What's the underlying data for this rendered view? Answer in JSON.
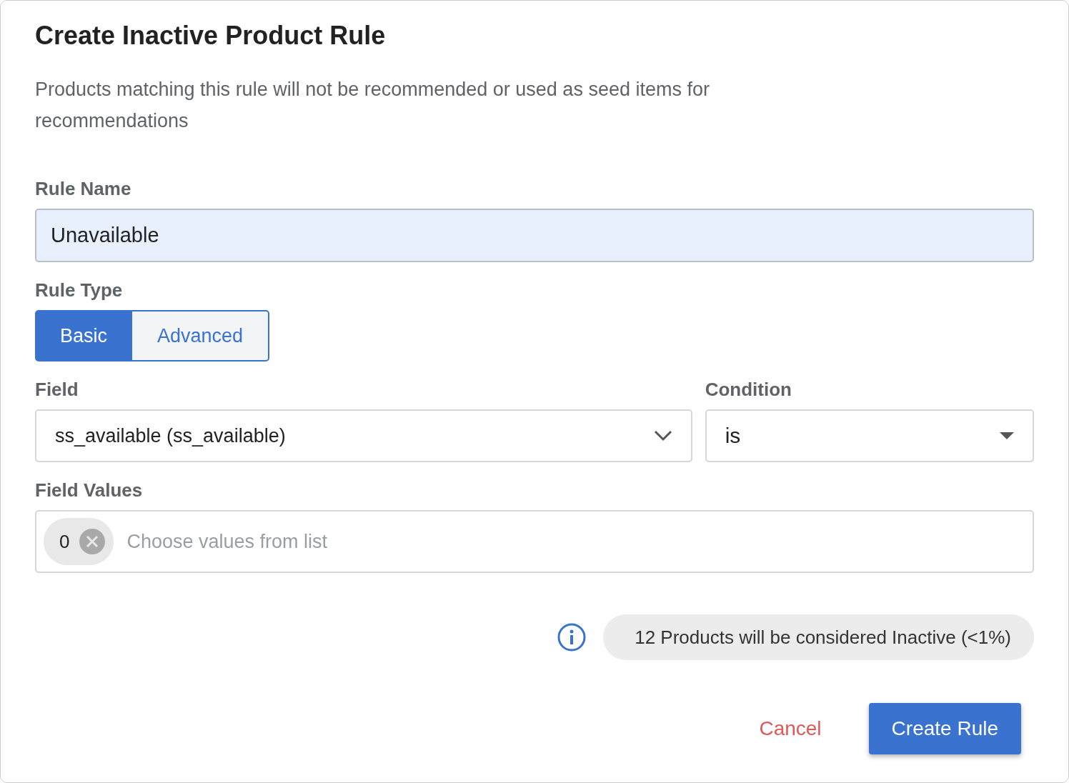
{
  "dialog": {
    "title": "Create Inactive Product Rule",
    "description": "Products matching this rule will not be recommended or used as seed items for recommendations"
  },
  "rule_name": {
    "label": "Rule Name",
    "value": "Unavailable"
  },
  "rule_type": {
    "label": "Rule Type",
    "options": [
      {
        "label": "Basic",
        "selected": true
      },
      {
        "label": "Advanced",
        "selected": false
      }
    ]
  },
  "field": {
    "label": "Field",
    "value": "ss_available (ss_available)"
  },
  "condition": {
    "label": "Condition",
    "value": "is"
  },
  "field_values": {
    "label": "Field Values",
    "chips": [
      "0"
    ],
    "placeholder": "Choose values from list"
  },
  "summary": "12 Products will be considered Inactive (<1%)",
  "buttons": [
    {
      "label": "Cancel",
      "kind": "text"
    },
    {
      "label": "Create Rule",
      "kind": "primary"
    }
  ]
}
